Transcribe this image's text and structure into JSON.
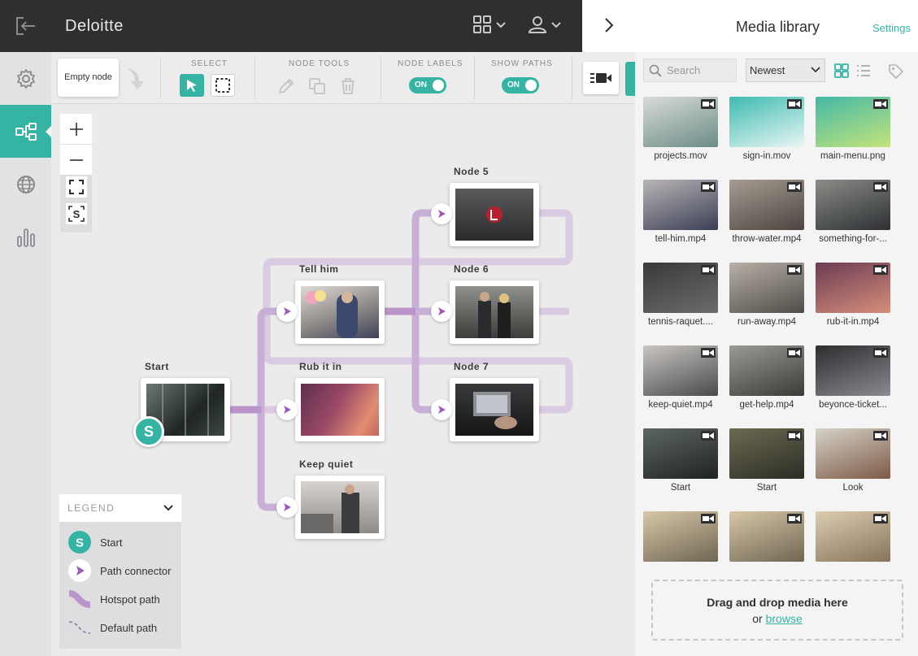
{
  "app": {
    "brand": "Deloitte"
  },
  "rail": {
    "items": [
      "gear-icon",
      "node-graph-icon",
      "globe-icon",
      "bar-chart-icon"
    ],
    "active": 1
  },
  "toolbar": {
    "empty_node_label": "Empty node",
    "select_label": "SELECT",
    "node_tools_label": "NODE TOOLS",
    "node_labels_label": "NODE LABELS",
    "show_paths_label": "SHOW PATHS",
    "node_labels_state": "ON",
    "show_paths_state": "ON"
  },
  "canvas": {
    "nodes": [
      {
        "id": "start",
        "title": "Start"
      },
      {
        "id": "tell",
        "title": "Tell him"
      },
      {
        "id": "rub",
        "title": "Rub it in"
      },
      {
        "id": "keep",
        "title": "Keep quiet"
      },
      {
        "id": "n5",
        "title": "Node 5"
      },
      {
        "id": "n6",
        "title": "Node 6"
      },
      {
        "id": "n7",
        "title": "Node 7"
      }
    ],
    "start_badge": "S"
  },
  "legend": {
    "title": "LEGEND",
    "items": [
      {
        "label": "Start",
        "icon": "start-badge-icon"
      },
      {
        "label": "Path connector",
        "icon": "path-connector-icon"
      },
      {
        "label": "Hotspot path",
        "icon": "hotspot-path-icon"
      },
      {
        "label": "Default path",
        "icon": "default-path-icon"
      }
    ]
  },
  "media_library": {
    "title": "Media library",
    "settings_label": "Settings",
    "search_placeholder": "Search",
    "sort_value": "Newest",
    "drop_text": "Drag and drop media here",
    "drop_or": "or",
    "drop_browse": "browse",
    "items": [
      {
        "name": "projects.mov",
        "color1": "#d9dbd8",
        "color2": "#6b8c86"
      },
      {
        "name": "sign-in.mov",
        "color1": "#3dbbb0",
        "color2": "#eaf6f4"
      },
      {
        "name": "main-menu.png",
        "color1": "#43b9a6",
        "color2": "#c4e37c"
      },
      {
        "name": "tell-him.mp4",
        "color1": "#b9b4b6",
        "color2": "#3b3f55"
      },
      {
        "name": "throw-water.mp4",
        "color1": "#a69c92",
        "color2": "#4c4440"
      },
      {
        "name": "something-for-...",
        "color1": "#8a8d87",
        "color2": "#2d2f34"
      },
      {
        "name": "tennis-raquet....",
        "color1": "#3a3a3c",
        "color2": "#6b6b6e"
      },
      {
        "name": "run-away.mp4",
        "color1": "#b6b0a6",
        "color2": "#514c48"
      },
      {
        "name": "rub-it-in.mp4",
        "color1": "#6b3c54",
        "color2": "#d68e7a"
      },
      {
        "name": "keep-quiet.mp4",
        "color1": "#c9c6c2",
        "color2": "#4a4a4c"
      },
      {
        "name": "get-help.mp4",
        "color1": "#9b9a95",
        "color2": "#3b3a38"
      },
      {
        "name": "beyonce-ticket...",
        "color1": "#2d2c2e",
        "color2": "#8a8b92"
      },
      {
        "name": "Start",
        "color1": "#5d6663",
        "color2": "#1f2322"
      },
      {
        "name": "Start",
        "color1": "#6d6a52",
        "color2": "#2b2d25"
      },
      {
        "name": "Look",
        "color1": "#d6d2c8",
        "color2": "#7d5a46"
      },
      {
        "name": "",
        "color1": "#d8c7a8",
        "color2": "#6f6652"
      },
      {
        "name": "",
        "color1": "#d8c7a8",
        "color2": "#6f6652"
      },
      {
        "name": "",
        "color1": "#dccdb0",
        "color2": "#87735c"
      }
    ]
  },
  "colors": {
    "accent": "#35b3a3",
    "path": "#a378b8",
    "path_light": "#d7c6e0",
    "dark": "#2f2f31"
  }
}
